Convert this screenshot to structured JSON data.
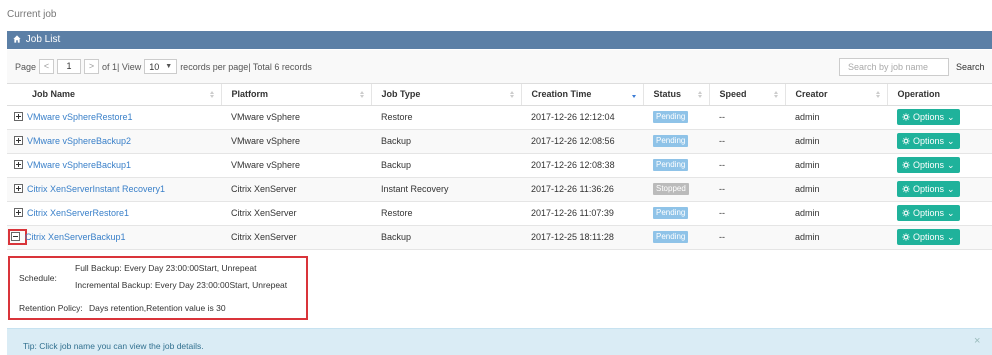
{
  "page": {
    "title": "Current job"
  },
  "panel": {
    "title": "Job List"
  },
  "pager": {
    "page_label": "Page",
    "prev": "<",
    "page_value": "1",
    "next": ">",
    "of_text": "of 1| View",
    "per_page_value": "10",
    "summary": "records per page| Total 6 records"
  },
  "search": {
    "placeholder": "Search by job name",
    "button": "Search"
  },
  "columns": [
    "Job Name",
    "Platform",
    "Job Type",
    "Creation Time",
    "Status",
    "Speed",
    "Creator",
    "Operation"
  ],
  "rows": [
    {
      "name": "VMware vSphereRestore1",
      "platform": "VMware vSphere",
      "type": "Restore",
      "created": "2017-12-26 12:12:04",
      "status": "Pending",
      "speed": "--",
      "creator": "admin",
      "operation": "Options"
    },
    {
      "name": "VMware vSphereBackup2",
      "platform": "VMware vSphere",
      "type": "Backup",
      "created": "2017-12-26 12:08:56",
      "status": "Pending",
      "speed": "--",
      "creator": "admin",
      "operation": "Options"
    },
    {
      "name": "VMware vSphereBackup1",
      "platform": "VMware vSphere",
      "type": "Backup",
      "created": "2017-12-26 12:08:38",
      "status": "Pending",
      "speed": "--",
      "creator": "admin",
      "operation": "Options"
    },
    {
      "name": "Citrix XenServerInstant Recovery1",
      "platform": "Citrix XenServer",
      "type": "Instant Recovery",
      "created": "2017-12-26 11:36:26",
      "status": "Stopped",
      "speed": "--",
      "creator": "admin",
      "operation": "Options"
    },
    {
      "name": "Citrix XenServerRestore1",
      "platform": "Citrix XenServer",
      "type": "Restore",
      "created": "2017-12-26 11:07:39",
      "status": "Pending",
      "speed": "--",
      "creator": "admin",
      "operation": "Options"
    },
    {
      "name": "Citrix XenServerBackup1",
      "platform": "Citrix XenServer",
      "type": "Backup",
      "created": "2017-12-25 18:11:28",
      "status": "Pending",
      "speed": "--",
      "creator": "admin",
      "operation": "Options"
    }
  ],
  "details": {
    "schedule_label": "Schedule:",
    "full_backup": "Full Backup: Every Day 23:00:00Start, Unrepeat",
    "incremental_backup": "Incremental Backup: Every Day 23:00:00Start, Unrepeat",
    "retention_label": "Retention Policy:",
    "retention_value": "Days retention,Retention value is 30"
  },
  "tip": {
    "text": "Tip: Click job name you can view the job details.",
    "close": "×"
  },
  "colors": {
    "header_bar": "#5b7fa6",
    "pending": "#8fc3e8",
    "stopped": "#bbbbbb",
    "options_button": "#1fb29b",
    "highlight": "#d9343a",
    "link": "#3a80c9",
    "tip_bg": "#daecf5"
  }
}
